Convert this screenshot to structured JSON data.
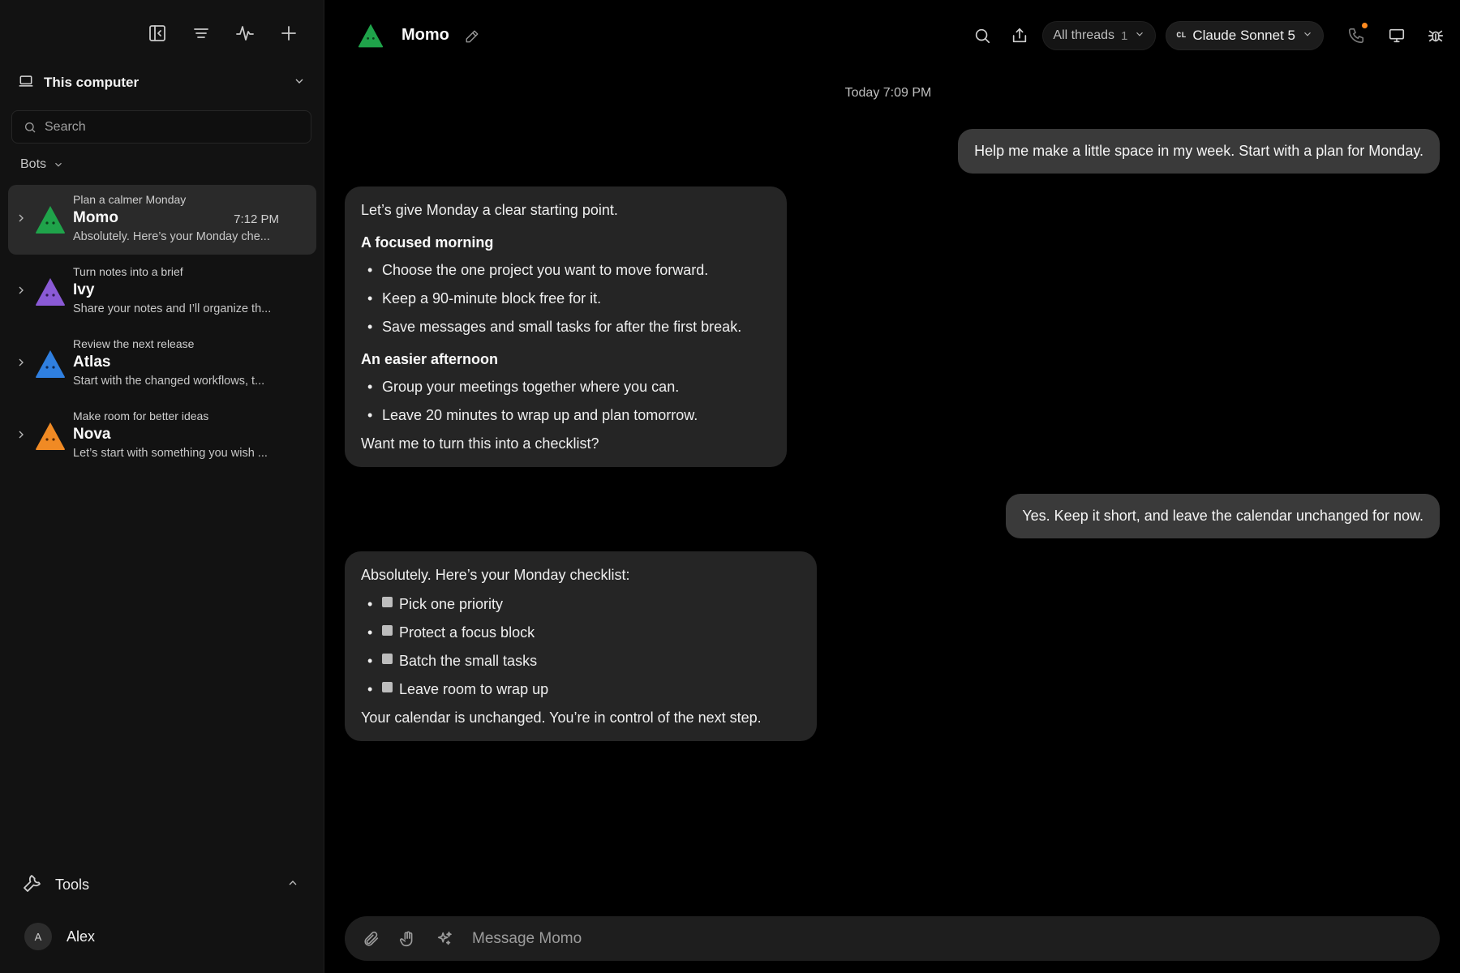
{
  "colors": {
    "momo": "#1fa34a",
    "ivy": "#8a5ad6",
    "atlas": "#2f7fe0",
    "nova": "#f08a24",
    "notification": "#ff8a1f"
  },
  "sidebar": {
    "toolbar": [
      "sidebar-toggle-icon",
      "list-icon",
      "activity-icon",
      "plus-icon"
    ],
    "workspace": {
      "label": "This computer"
    },
    "search": {
      "placeholder": "Search"
    },
    "bots_header": "Bots",
    "bots": [
      {
        "subtitle": "Plan a calmer Monday",
        "name": "Momo",
        "time": "7:12 PM",
        "preview": "Absolutely. Here’s your Monday che...",
        "color": "#1fa34a",
        "active": true
      },
      {
        "subtitle": "Turn notes into a brief",
        "name": "Ivy",
        "time": "",
        "preview": "Share your notes and I’ll organize th...",
        "color": "#8a5ad6",
        "active": false
      },
      {
        "subtitle": "Review the next release",
        "name": "Atlas",
        "time": "",
        "preview": "Start with the changed workflows, t...",
        "color": "#2f7fe0",
        "active": false
      },
      {
        "subtitle": "Make room for better ideas",
        "name": "Nova",
        "time": "",
        "preview": "Let’s start with something you wish ...",
        "color": "#f08a24",
        "active": false
      }
    ],
    "tools_label": "Tools",
    "user": {
      "initial": "A",
      "name": "Alex"
    }
  },
  "header": {
    "title": "Momo",
    "threads": {
      "label": "All threads",
      "count": "1"
    },
    "model": {
      "badge": "CL",
      "label": "Claude Sonnet 5"
    }
  },
  "chat": {
    "timestamp": "Today 7:09 PM",
    "user_msg_1": "Help me make a little space in my week. Start with a plan for Monday.",
    "bot_msg_1": {
      "intro": "Let’s give Monday a clear starting point.",
      "heading_1": "A focused morning",
      "items_1": [
        "Choose the one project you want to move forward.",
        "Keep a 90-minute block free for it.",
        "Save messages and small tasks for after the first break."
      ],
      "heading_2": "An easier afternoon",
      "items_2": [
        "Group your meetings together where you can.",
        "Leave 20 minutes to wrap up and plan tomorrow."
      ],
      "outro": "Want me to turn this into a checklist?"
    },
    "user_msg_2": "Yes. Keep it short, and leave the calendar unchanged for now.",
    "bot_msg_2": {
      "intro": "Absolutely. Here’s your Monday checklist:",
      "checklist": [
        "Pick one priority",
        "Protect a focus block",
        "Batch the small tasks",
        "Leave room to wrap up"
      ],
      "outro": "Your calendar is unchanged. You’re in control of the next step."
    }
  },
  "composer": {
    "placeholder": "Message Momo"
  }
}
